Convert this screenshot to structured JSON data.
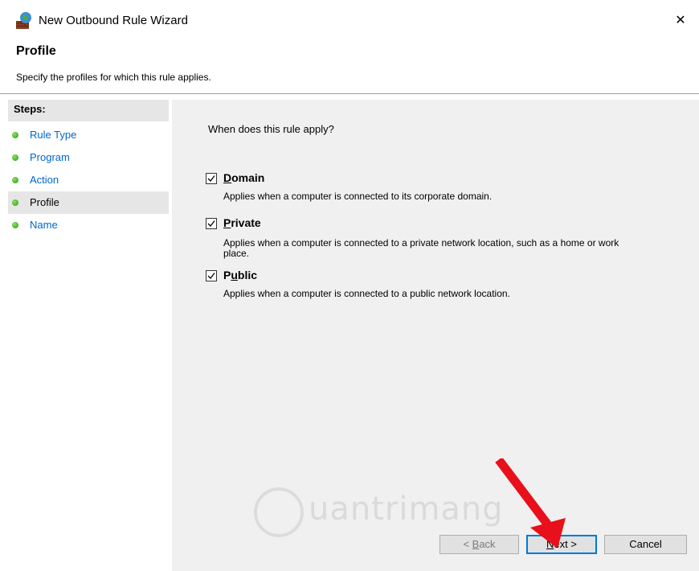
{
  "window": {
    "title": "New Outbound Rule Wizard",
    "close_glyph": "✕"
  },
  "header": {
    "title": "Profile",
    "subtitle": "Specify the profiles for which this rule applies."
  },
  "steps": {
    "heading": "Steps:",
    "items": [
      {
        "label": "Rule Type",
        "state": "link"
      },
      {
        "label": "Program",
        "state": "link"
      },
      {
        "label": "Action",
        "state": "link"
      },
      {
        "label": "Profile",
        "state": "current"
      },
      {
        "label": "Name",
        "state": "link"
      }
    ]
  },
  "main": {
    "question": "When does this rule apply?",
    "options": [
      {
        "label_access": "D",
        "label_rest": "omain",
        "checked": true,
        "description": "Applies when a computer is connected to its corporate domain."
      },
      {
        "label_access": "P",
        "label_rest": "rivate",
        "checked": true,
        "description": "Applies when a computer is connected to a private network location, such as a home or work place."
      },
      {
        "label_pre": "P",
        "label_access": "u",
        "label_rest": "blic",
        "checked": true,
        "description": "Applies when a computer is connected to a public network location."
      }
    ]
  },
  "buttons": {
    "back": {
      "pre": "< ",
      "access": "B",
      "rest": "ack"
    },
    "next": {
      "access": "N",
      "rest": "ext >"
    },
    "cancel": {
      "label": "Cancel"
    }
  },
  "watermark": {
    "text": "uantrimang"
  },
  "colors": {
    "link": "#0066cc",
    "panel": "#f0f0f0",
    "step_dot": "#3fae24",
    "arrow": "#e8101a",
    "default_button_border": "#0078d7"
  },
  "icons": {
    "title": "firewall-icon",
    "close": "close-icon",
    "step": "green-dot-icon",
    "check": "check-icon",
    "arrow": "red-arrow-annotation"
  }
}
